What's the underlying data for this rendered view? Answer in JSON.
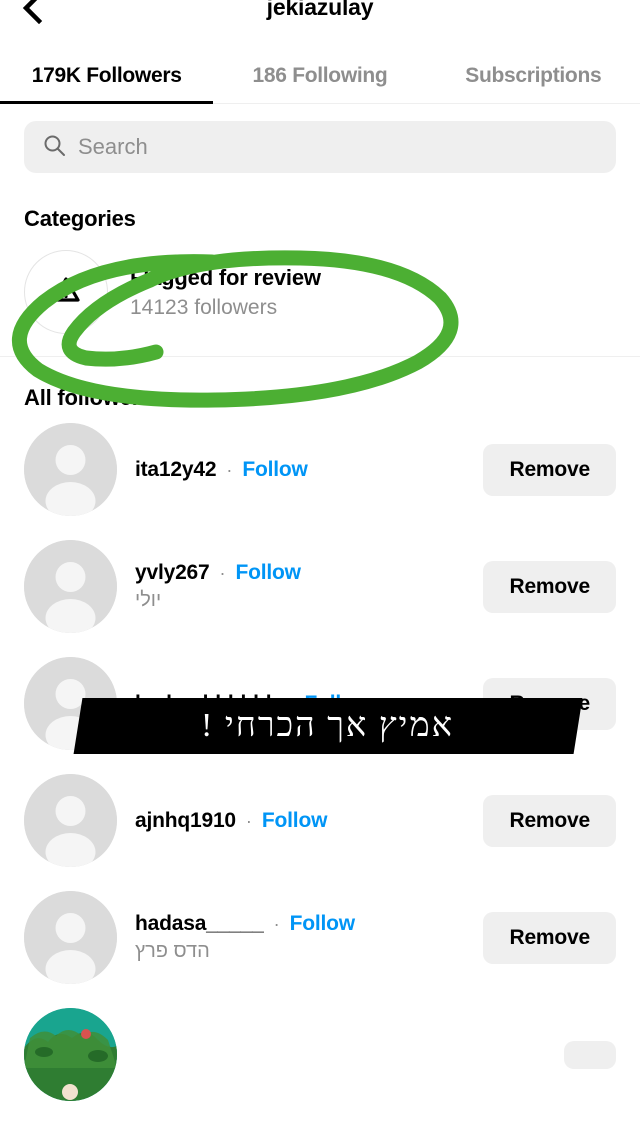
{
  "header": {
    "back_icon": "back-chevron-icon",
    "title": "jekiazulay"
  },
  "tabs": [
    {
      "label": "179K Followers",
      "active": true
    },
    {
      "label": "186 Following",
      "active": false
    },
    {
      "label": "Subscriptions",
      "active": false
    }
  ],
  "search": {
    "icon": "search-icon",
    "placeholder": "Search",
    "value": ""
  },
  "categories": {
    "heading": "Categories",
    "items": [
      {
        "icon": "warning-triangle-icon",
        "title": "Flagged for review",
        "subtitle": "14123 followers"
      }
    ]
  },
  "all_followers": {
    "heading": "All followers",
    "rows": [
      {
        "username": "ita12y42",
        "separator": "·",
        "follow_label": "Follow",
        "fullname": "",
        "action_label": "Remove",
        "avatar": "placeholder"
      },
      {
        "username": "yvly267",
        "separator": "·",
        "follow_label": "Follow",
        "fullname": "יולי",
        "action_label": "Remove",
        "avatar": "placeholder"
      },
      {
        "username": "hadar_bbbbbb",
        "separator": "·",
        "follow_label": "Follow",
        "fullname": "",
        "action_label": "Remove",
        "avatar": "placeholder"
      },
      {
        "username": "ajnhq1910",
        "separator": "·",
        "follow_label": "Follow",
        "fullname": "",
        "action_label": "Remove",
        "avatar": "placeholder"
      },
      {
        "username": "hadasa_____",
        "separator": "·",
        "follow_label": "Follow",
        "fullname": "הדס פרץ",
        "action_label": "Remove",
        "avatar": "placeholder"
      },
      {
        "username": "",
        "separator": "",
        "follow_label": "",
        "fullname": "",
        "action_label": "",
        "avatar": "photo"
      }
    ]
  },
  "annotations": {
    "circle_color": "#4caf33",
    "banner_text": "אמיץ אך הכרחי !",
    "banner_bg": "#000000",
    "banner_text_color": "#ffffff"
  },
  "colors": {
    "link_blue": "#0095f6",
    "muted_gray": "#8e8e8e",
    "field_gray": "#efefef",
    "avatar_gray": "#dbdbdb"
  }
}
